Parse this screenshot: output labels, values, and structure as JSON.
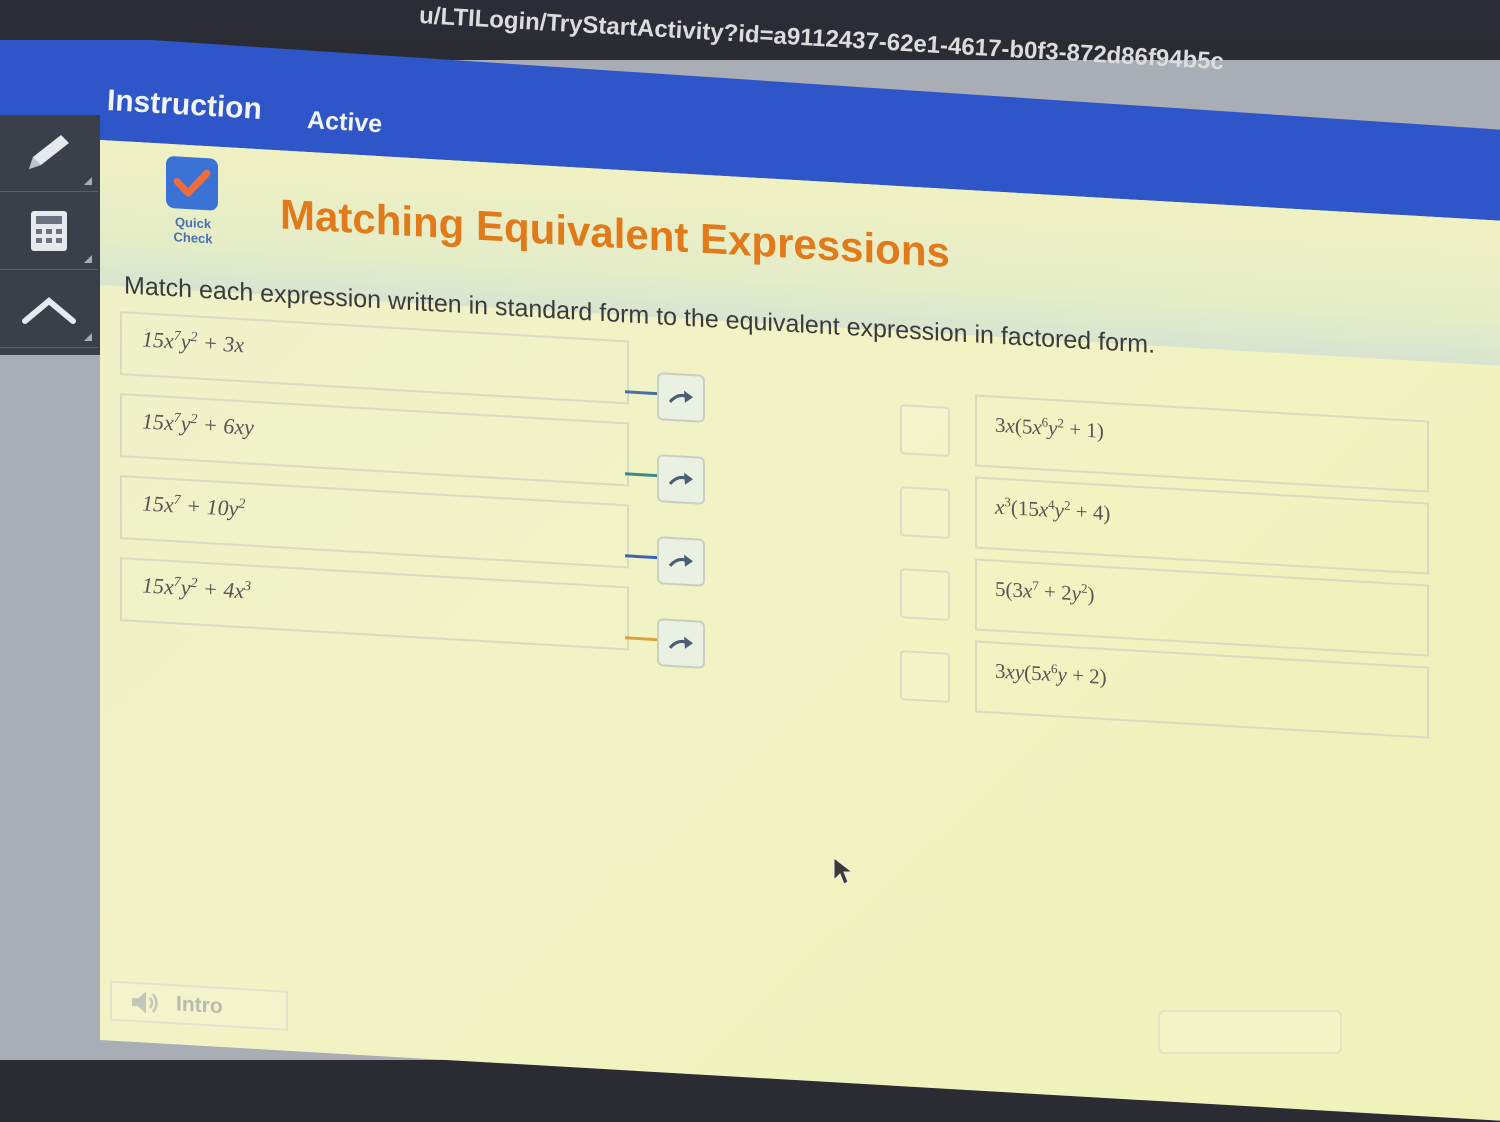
{
  "browser": {
    "url": "u/LTILogin/TryStartActivity?id=a9112437-62e1-4617-b0f3-872d86f94b5c"
  },
  "tabs": [
    {
      "label": "Instruction"
    },
    {
      "label": "Active"
    }
  ],
  "sidebar": {
    "tools": [
      "pencil-icon",
      "calculator-icon",
      "up-arrow-icon"
    ]
  },
  "activity": {
    "badge_label": "Quick Check",
    "title": "Matching Equivalent Expressions",
    "instructions": "Match each expression written in standard form to the equivalent expression in factored form."
  },
  "left_expressions": [
    {
      "html": "15x<sup>7</sup>y<sup>2</sup> + 3x",
      "connector_color": "#4a6fa5"
    },
    {
      "html": "15x<sup>7</sup>y<sup>2</sup> + 6xy",
      "connector_color": "#3a8a88"
    },
    {
      "html": "15x<sup>7</sup> + 10y<sup>2</sup>",
      "connector_color": "#3e62b8"
    },
    {
      "html": "15x<sup>7</sup>y<sup>2</sup> + 4x<sup>3</sup>",
      "connector_color": "#d9a43a"
    }
  ],
  "right_expressions": [
    {
      "html": "3<i>x</i>(5<i>x</i><sup>6</sup><i>y</i><sup>2</sup> + 1)"
    },
    {
      "html": "<i>x</i><sup>3</sup>(15<i>x</i><sup>4</sup><i>y</i><sup>2</sup> + 4)"
    },
    {
      "html": "5(3<i>x</i><sup>7</sup> + 2<i>y</i><sup>2</sup>)"
    },
    {
      "html": "3<i>xy</i>(5<i>x</i><sup>6</sup><i>y</i> + 2)"
    }
  ],
  "footer": {
    "intro_label": "Intro"
  },
  "colors": {
    "accent_title": "#e07a1a",
    "header_blue": "#2f56c9"
  }
}
